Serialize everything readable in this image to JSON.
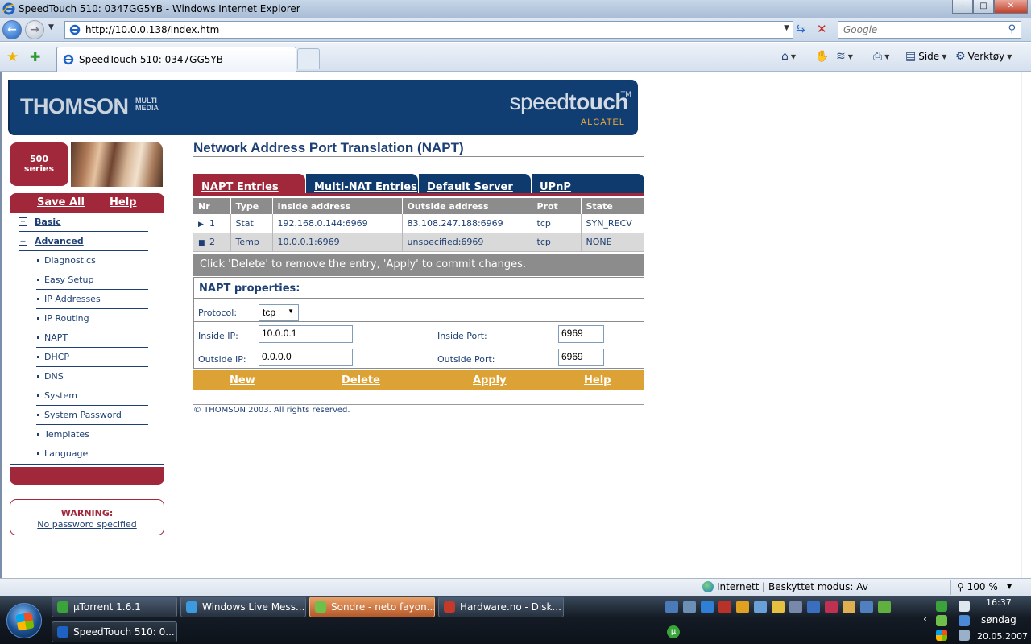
{
  "window": {
    "title": "SpeedTouch 510:  0347GG5YB - Windows Internet Explorer",
    "controls": [
      "–",
      "□",
      "✕"
    ]
  },
  "browser": {
    "url": "http://10.0.0.138/index.htm",
    "search_placeholder": "Google",
    "tab_title": "SpeedTouch 510:  0347GG5YB",
    "cmd_page": "Side",
    "cmd_tools": "Verktøy",
    "status_zone": "Internett | Beskyttet modus: Av",
    "zoom": "100 %"
  },
  "brand": {
    "thomson": "THOMSON",
    "multimedia": "MULTI MEDIA",
    "speed": "speed",
    "touch": "touch",
    "tm": "TM",
    "alcatel": "ALCATEL"
  },
  "sidebar": {
    "series_line1": "500",
    "series_line2": "series",
    "save_all": "Save All",
    "help": "Help",
    "basic": "Basic",
    "advanced": "Advanced",
    "items": [
      "Diagnostics",
      "Easy Setup",
      "IP Addresses",
      "IP Routing",
      "NAPT",
      "DHCP",
      "DNS",
      "System",
      "System Password",
      "Templates",
      "Language"
    ],
    "warning_title": "WARNING:",
    "warning_link": "No password specified"
  },
  "main": {
    "title": "Network Address Port Translation (NAPT)",
    "tabs": [
      "NAPT Entries",
      "Multi-NAT Entries",
      "Default Server",
      "UPnP"
    ],
    "columns": [
      "Nr",
      "Type",
      "Inside address",
      "Outside address",
      "Prot",
      "State"
    ],
    "rows": [
      {
        "marker": "▶",
        "nr": "1",
        "type": "Stat",
        "inside": "192.168.0.144:6969",
        "outside": "83.108.247.188:6969",
        "prot": "tcp",
        "state": "SYN_RECV"
      },
      {
        "marker": "■",
        "nr": "2",
        "type": "Temp",
        "inside": "10.0.0.1:6969",
        "outside": "unspecified:6969",
        "prot": "tcp",
        "state": "NONE"
      }
    ],
    "hint": "Click 'Delete' to remove the entry, 'Apply' to commit changes.",
    "props_title": "NAPT properties:",
    "protocol_label": "Protocol:",
    "protocol_value": "tcp",
    "inside_ip_label": "Inside IP:",
    "inside_ip_value": "10.0.0.1",
    "outside_ip_label": "Outside IP:",
    "outside_ip_value": "0.0.0.0",
    "inside_port_label": "Inside Port:",
    "inside_port_value": "6969",
    "outside_port_label": "Outside Port:",
    "outside_port_value": "6969",
    "actions": [
      "New",
      "Delete",
      "Apply",
      "Help"
    ],
    "copyright": "© THOMSON 2003. All rights reserved."
  },
  "taskbar": {
    "buttons": [
      "µTorrent 1.6.1",
      "Windows Live Mess...",
      "Sondre - neto fayon...",
      "Hardware.no - Disk...",
      "SpeedTouch 510:  0..."
    ],
    "clock_time": "16:37",
    "clock_day": "søndag",
    "clock_date": "20.05.2007"
  },
  "colors": {
    "thomson_blue": "#103d72",
    "maroon": "#a0283a",
    "gold": "#dda236",
    "grey": "#8c8c8c"
  }
}
